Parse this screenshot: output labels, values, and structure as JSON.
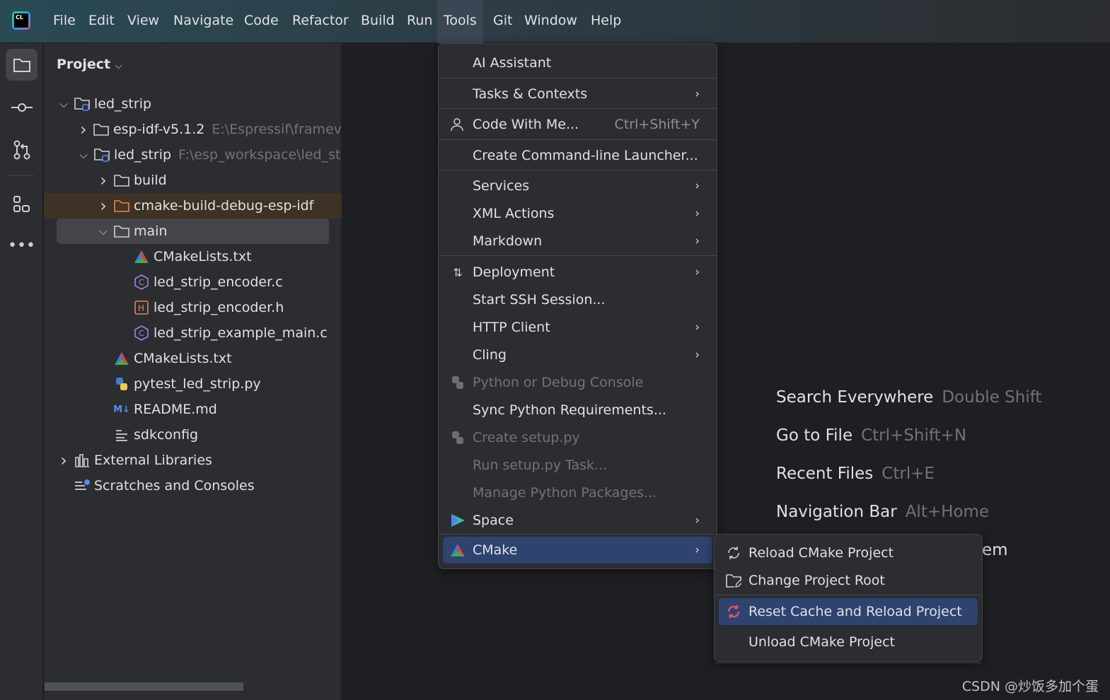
{
  "menubar": {
    "items": [
      "File",
      "Edit",
      "View",
      "Navigate",
      "Code",
      "Refactor",
      "Build",
      "Run",
      "Tools",
      "Git",
      "Window",
      "Help"
    ],
    "active": "Tools"
  },
  "stripe": {
    "icons": [
      "folder-icon",
      "commit-icon",
      "pull-request-icon",
      "structure-icon",
      "more-icon"
    ]
  },
  "project": {
    "title": "Project",
    "tree": [
      {
        "label": "led_strip",
        "hint": "",
        "depth": 0,
        "chev": "v",
        "icon": "module-folder"
      },
      {
        "label": "esp-idf-v5.1.2",
        "hint": "E:\\Espressif\\framev",
        "depth": 1,
        "chev": ">",
        "icon": "folder"
      },
      {
        "label": "led_strip",
        "hint": "F:\\esp_workspace\\led_st",
        "depth": 1,
        "chev": "v",
        "icon": "module-folder"
      },
      {
        "label": "build",
        "hint": "",
        "depth": 2,
        "chev": ">",
        "icon": "folder"
      },
      {
        "label": "cmake-build-debug-esp-idf",
        "hint": "",
        "depth": 2,
        "chev": ">",
        "icon": "folder-excluded"
      },
      {
        "label": "main",
        "hint": "",
        "depth": 2,
        "chev": "v",
        "icon": "folder"
      },
      {
        "label": "CMakeLists.txt",
        "hint": "",
        "depth": 3,
        "chev": "",
        "icon": "cmake"
      },
      {
        "label": "led_strip_encoder.c",
        "hint": "",
        "depth": 3,
        "chev": "",
        "icon": "c-file"
      },
      {
        "label": "led_strip_encoder.h",
        "hint": "",
        "depth": 3,
        "chev": "",
        "icon": "h-file"
      },
      {
        "label": "led_strip_example_main.c",
        "hint": "",
        "depth": 3,
        "chev": "",
        "icon": "c-file"
      },
      {
        "label": "CMakeLists.txt",
        "hint": "",
        "depth": 2,
        "chev": "",
        "icon": "cmake"
      },
      {
        "label": "pytest_led_strip.py",
        "hint": "",
        "depth": 2,
        "chev": "",
        "icon": "python"
      },
      {
        "label": "README.md",
        "hint": "",
        "depth": 2,
        "chev": "",
        "icon": "markdown"
      },
      {
        "label": "sdkconfig",
        "hint": "",
        "depth": 2,
        "chev": "",
        "icon": "config"
      },
      {
        "label": "External Libraries",
        "hint": "",
        "depth": 0,
        "chev": ">",
        "icon": "library"
      },
      {
        "label": "Scratches and Consoles",
        "hint": "",
        "depth": 0,
        "chev": "",
        "icon": "scratches"
      }
    ]
  },
  "tools_menu": {
    "items": [
      {
        "label": "AI Assistant",
        "submenu": false
      },
      {
        "label": "Tasks & Contexts",
        "submenu": true
      },
      {
        "label": "Code With Me...",
        "shortcut": "Ctrl+Shift+Y",
        "icon": "user-icon"
      },
      {
        "label": "Create Command-line Launcher..."
      },
      {
        "label": "Services",
        "submenu": true
      },
      {
        "label": "XML Actions",
        "submenu": true
      },
      {
        "label": "Markdown",
        "submenu": true
      },
      {
        "label": "Deployment",
        "submenu": true,
        "icon": "deployment-icon"
      },
      {
        "label": "Start SSH Session..."
      },
      {
        "label": "HTTP Client",
        "submenu": true
      },
      {
        "label": "Cling",
        "submenu": true
      },
      {
        "label": "Python or Debug Console",
        "disabled": true,
        "icon": "python-icon"
      },
      {
        "label": "Sync Python Requirements..."
      },
      {
        "label": "Create setup.py",
        "disabled": true,
        "icon": "python-icon"
      },
      {
        "label": "Run setup.py Task...",
        "disabled": true
      },
      {
        "label": "Manage Python Packages...",
        "disabled": true
      },
      {
        "label": "Space",
        "submenu": true,
        "icon": "space-icon"
      },
      {
        "label": "CMake",
        "submenu": true,
        "icon": "cmake-icon",
        "selected": true
      }
    ]
  },
  "cmake_submenu": {
    "items": [
      {
        "label": "Reload CMake Project",
        "icon": "reload-icon"
      },
      {
        "label": "Change Project Root",
        "icon": "folder-edit-icon"
      },
      {
        "label": "Reset Cache and Reload Project",
        "icon": "reset-cache-icon",
        "selected": true
      },
      {
        "label": "Unload CMake Project"
      }
    ]
  },
  "editor_tips": [
    {
      "action": "Search Everywhere",
      "key": "Double Shift"
    },
    {
      "action": "Go to File",
      "key": "Ctrl+Shift+N"
    },
    {
      "action": "Recent Files",
      "key": "Ctrl+E"
    },
    {
      "action": "Navigation Bar",
      "key": "Alt+Home"
    },
    {
      "action": "em",
      "key": ""
    }
  ],
  "watermark": "CSDN @炒饭多加个蛋",
  "colors": {
    "selection": "#2e436e",
    "excluded_row": "#3d3223",
    "accent_reset": "#e0556a"
  }
}
